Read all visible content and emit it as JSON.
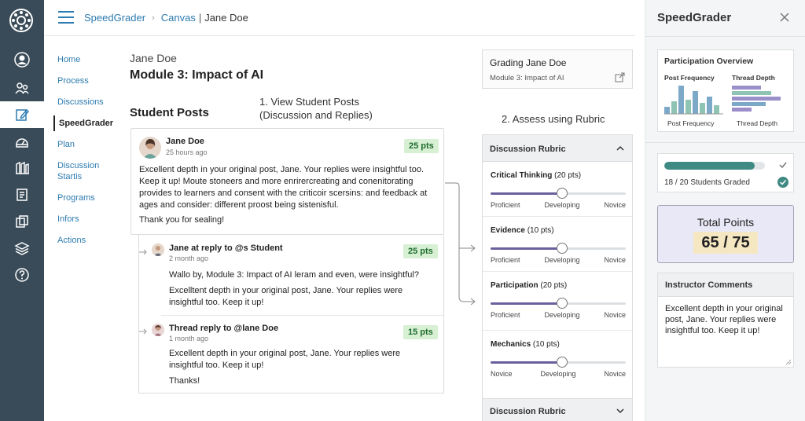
{
  "header": {
    "crumb_app": "SpeedGrader",
    "crumb_sep": "›",
    "crumb_course": "Canvas",
    "crumb_bar": "|",
    "crumb_student": "Jane Doe"
  },
  "course_nav": [
    {
      "label": "Home"
    },
    {
      "label": "Process"
    },
    {
      "label": "Discussions"
    },
    {
      "label": "SpeedGrader",
      "active": true
    },
    {
      "label": "Plan"
    },
    {
      "label": "Discussion Startis"
    },
    {
      "label": "Programs"
    },
    {
      "label": "Infors"
    },
    {
      "label": "Actions"
    }
  ],
  "main": {
    "student_name": "Jane Doe",
    "module_title": "Module 3: Impact of AI",
    "posts_heading": "Student Posts",
    "step1_line1": "1. View Student Posts",
    "step1_line2": "(Discussion and Replies)",
    "step2": "2. Assess using Rubric"
  },
  "post": {
    "author": "Jane Doe",
    "time": "25 hours ago",
    "points": "25 pts",
    "text": "Excellent depth in your original post, Jane. Your replies were insightful too. Keep it up! Moute stoneers and more enrirercreating and conenitorating provides to learners and consent with the criticoir scersins: and feedback at ages and consider: different proost being sistenisful.",
    "thanks": "Thank you for sealing!"
  },
  "replies": [
    {
      "author": "Jane at reply to @s Student",
      "time": "2 month ago",
      "points": "25 pts",
      "line1": "Wallo by, Module 3: Impact of AI leram and even, were insightful?",
      "line2": "Excelltent depth in your original post, Jane. Your replies were insightful too. Keep it up!"
    },
    {
      "author": "Thread reply to @lane Doe",
      "time": "1 month ago",
      "points": "15 pts",
      "line1": "Excellent depth in your original post, Jane. Your replies were insightful too. Keep it up!",
      "line2": "Thanks!"
    }
  ],
  "grading_card": {
    "title": "Grading Jane Doe",
    "subtitle": "Module 3: Impact of AI"
  },
  "rubric": {
    "title": "Discussion Rubric",
    "footer_title": "Discussion Rubric",
    "criteria": [
      {
        "name": "Critical Thinking",
        "pts": "(20 pts)",
        "value": 0.53,
        "levels": [
          "Proficient",
          "Developing",
          "Novice"
        ]
      },
      {
        "name": "Evidence",
        "pts": "(10 pts)",
        "value": 0.53,
        "levels": [
          "Proficient",
          "Developing",
          "Novice"
        ]
      },
      {
        "name": "Participation",
        "pts": "(20 pts)",
        "value": 0.53,
        "levels": [
          "Proficient",
          "Developing",
          "Novice"
        ]
      },
      {
        "name": "Mechanics",
        "pts": "(10 pts)",
        "value": 0.53,
        "levels": [
          "Novice",
          "Developing",
          "Novice"
        ]
      }
    ]
  },
  "right_panel": {
    "title": "SpeedGrader",
    "overview": {
      "title": "Participation Overview",
      "left_label_top": "Post Frequency",
      "right_label_top": "Thread Depth",
      "left_label_bottom": "Post Frequency",
      "right_label_bottom": "Thread Depth",
      "post_frequency_bars": [
        0.25,
        0.45,
        1.0,
        0.5,
        0.8,
        0.4,
        0.6,
        0.3
      ],
      "thread_depth_bars": [
        0.6,
        0.8,
        1.0,
        0.7,
        0.4
      ],
      "colors": [
        "#7da9c9",
        "#8fc4b4",
        "#9b8fc9"
      ]
    },
    "graded": {
      "progress": 0.9,
      "text": "18 / 20 Students Graded"
    },
    "total": {
      "label": "Total Points",
      "value": "65 / 75"
    },
    "comments": {
      "title": "Instructor Comments",
      "text": "Excellent depth in your original post, Jane. Your replies were insightful too. Keep it up!"
    }
  },
  "colors": {
    "nav_bg": "#394b58",
    "link": "#2d7bb0",
    "pts_bg": "#d7f0d3",
    "slider": "#6b5f9e",
    "progress": "#3f8a83",
    "total_bg": "#e9e8f6",
    "total_value_bg": "#f6e7c3"
  }
}
